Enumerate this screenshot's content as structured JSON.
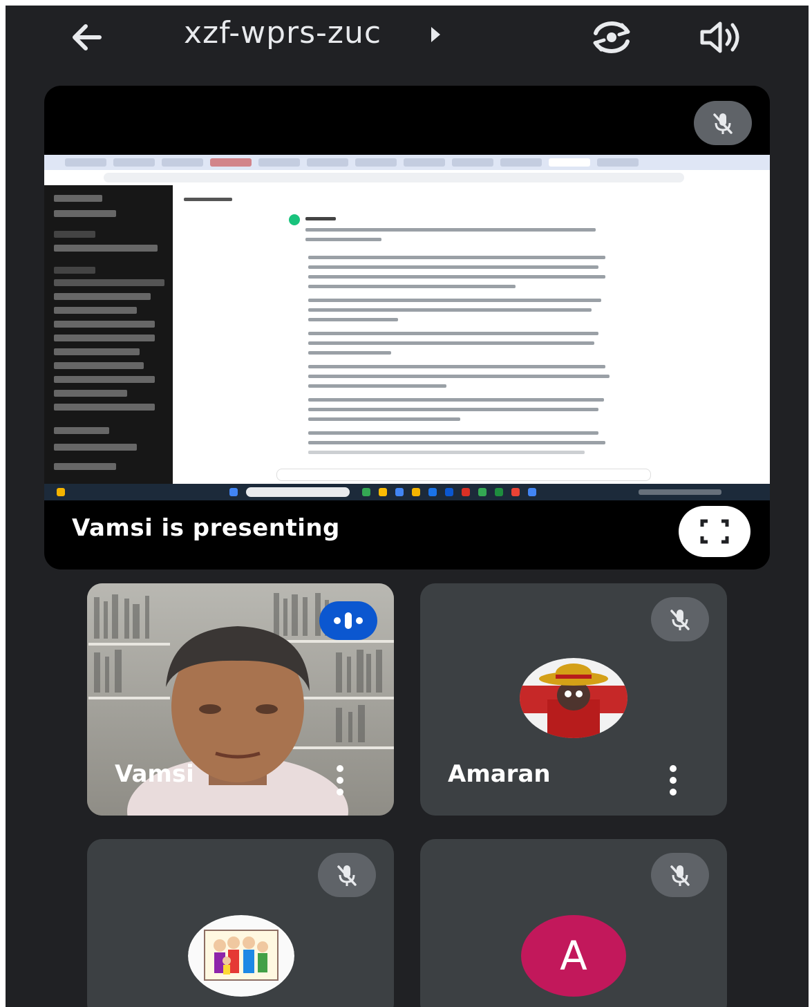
{
  "header": {
    "meeting_code": "xzf-wprs-zuc"
  },
  "presentation": {
    "presenting_label": "Vamsi is presenting"
  },
  "participants": [
    {
      "name": "Vamsi"
    },
    {
      "name": "Amaran"
    },
    {
      "name": ""
    },
    {
      "name": "",
      "initial": "A"
    }
  ],
  "icons": {
    "back": "arrow-left-icon",
    "code_details": "caret-right-icon",
    "switch_camera": "flip-camera-icon",
    "audio_output": "speaker-icon",
    "mic_off": "mic-off-icon",
    "fullscreen": "fullscreen-icon",
    "more": "more-vertical-icon",
    "speaking": "speaking-indicator-icon"
  },
  "colors": {
    "background": "#202124",
    "tile": "#3c4043",
    "speaking_badge": "#0b57d0",
    "letter_avatar": "#c2185b"
  }
}
